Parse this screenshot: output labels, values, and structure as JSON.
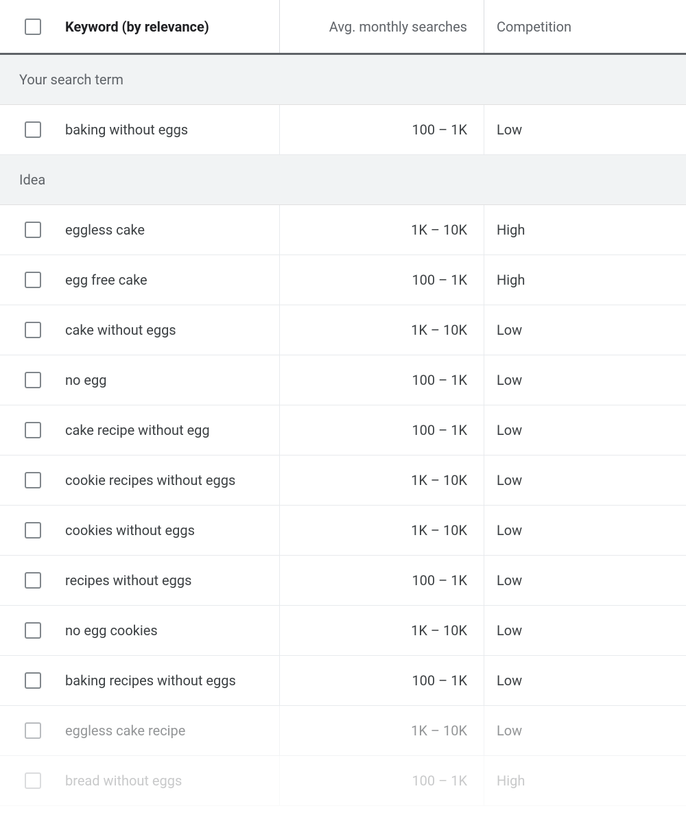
{
  "columns": {
    "keyword": "Keyword (by relevance)",
    "searches": "Avg. monthly searches",
    "competition": "Competition"
  },
  "sections": {
    "search_term": "Your search term",
    "idea": "Idea"
  },
  "search_term_rows": [
    {
      "keyword": "baking without eggs",
      "searches": "100 – 1K",
      "competition": "Low"
    }
  ],
  "idea_rows": [
    {
      "keyword": "eggless cake",
      "searches": "1K – 10K",
      "competition": "High"
    },
    {
      "keyword": "egg free cake",
      "searches": "100 – 1K",
      "competition": "High"
    },
    {
      "keyword": "cake without eggs",
      "searches": "1K – 10K",
      "competition": "Low"
    },
    {
      "keyword": "no egg",
      "searches": "100 – 1K",
      "competition": "Low"
    },
    {
      "keyword": "cake recipe without egg",
      "searches": "100 – 1K",
      "competition": "Low"
    },
    {
      "keyword": "cookie recipes without eggs",
      "searches": "1K – 10K",
      "competition": "Low"
    },
    {
      "keyword": "cookies without eggs",
      "searches": "1K – 10K",
      "competition": "Low"
    },
    {
      "keyword": "recipes without eggs",
      "searches": "100 – 1K",
      "competition": "Low"
    },
    {
      "keyword": "no egg cookies",
      "searches": "1K – 10K",
      "competition": "Low"
    },
    {
      "keyword": "baking recipes without eggs",
      "searches": "100 – 1K",
      "competition": "Low"
    },
    {
      "keyword": "eggless cake recipe",
      "searches": "1K – 10K",
      "competition": "Low"
    },
    {
      "keyword": "bread without eggs",
      "searches": "100 – 1K",
      "competition": "High"
    }
  ]
}
